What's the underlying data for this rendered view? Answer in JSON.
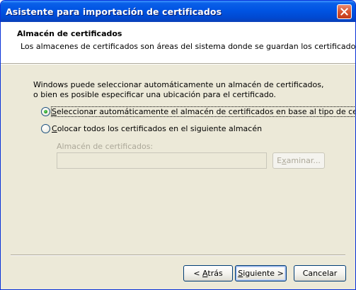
{
  "window": {
    "title": "Asistente para importación de certificados",
    "close_icon": "close-icon"
  },
  "header": {
    "title": "Almacén de certificados",
    "description": "Los almacenes de certificados son áreas del sistema donde se guardan los certificados."
  },
  "body": {
    "intro": "Windows puede seleccionar automáticamente un almacén de certificados, o bien es posible especificar una ubicación para el certificado.",
    "options": [
      {
        "label_mnemonic": "S",
        "label_rest": "eleccionar automáticamente el almacén de certificados en base al tipo de certificado",
        "selected": true
      },
      {
        "label_mnemonic": "C",
        "label_rest": "olocar todos los certificados en el siguiente almacén",
        "selected": false
      }
    ],
    "store_label": "Almacén de certificados:",
    "store_value": "",
    "browse": {
      "pre": "E",
      "mnemonic": "x",
      "post": "aminar...",
      "enabled": false
    }
  },
  "footer": {
    "back": {
      "pre": "< ",
      "mnemonic": "A",
      "post": "trás"
    },
    "next": {
      "pre": "",
      "mnemonic": "S",
      "post": "iguiente >"
    },
    "cancel": "Cancelar"
  },
  "colors": {
    "titlebar": "#0054e3",
    "dialog_bg": "#ece9d8",
    "header_bg": "#ffffff",
    "disabled_text": "#aca899",
    "radio_dot": "#21a121"
  }
}
